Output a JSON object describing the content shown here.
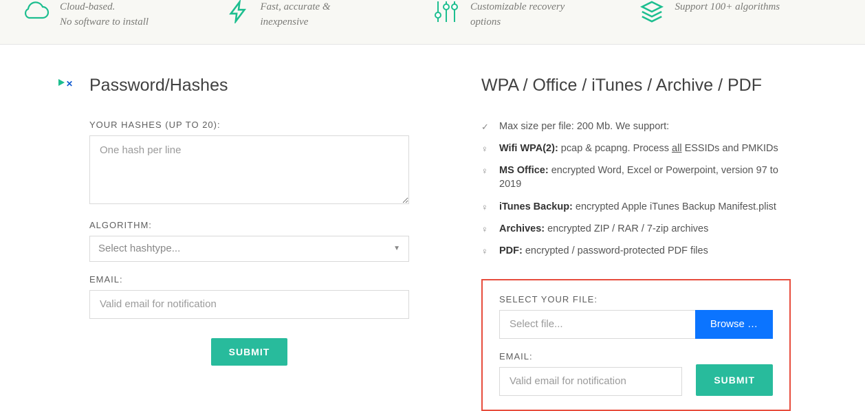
{
  "features": [
    {
      "line1": "Cloud-based.",
      "line2": "No software to install"
    },
    {
      "line1": "Fast, accurate &",
      "line2": "inexpensive"
    },
    {
      "line1": "Customizable recovery",
      "line2": "options"
    },
    {
      "line1": "Support 100+ algorithms",
      "line2": ""
    }
  ],
  "left": {
    "heading": "Password/Hashes",
    "hashes_label": "YOUR HASHES (UP TO 20):",
    "hashes_placeholder": "One hash per line",
    "algo_label": "ALGORITHM:",
    "algo_placeholder": "Select hashtype...",
    "email_label": "EMAIL:",
    "email_placeholder": "Valid email for notification",
    "submit": "SUBMIT"
  },
  "right": {
    "heading": "WPA / Office / iTunes / Archive / PDF",
    "intro_prefix": "Max size per file: 200 Mb. We support:",
    "items": {
      "wifi_label": "Wifi WPA(2):",
      "wifi_t1": " pcap & pcapng. Process ",
      "wifi_all": "all",
      "wifi_t2": " ESSIDs and PMKIDs",
      "office_label": "MS Office:",
      "office_text": " encrypted Word, Excel or Powerpoint, version 97 to 2019",
      "itunes_label": "iTunes Backup:",
      "itunes_text": " encrypted Apple iTunes Backup Manifest.plist",
      "arch_label": "Archives:",
      "arch_text": " encrypted ZIP / RAR / 7-zip archives",
      "pdf_label": "PDF:",
      "pdf_text": " encrypted / password-protected PDF files"
    },
    "file_label": "SELECT YOUR FILE:",
    "file_placeholder": "Select file...",
    "browse": "Browse …",
    "email_label": "EMAIL:",
    "email_placeholder": "Valid email for notification",
    "submit": "SUBMIT"
  }
}
